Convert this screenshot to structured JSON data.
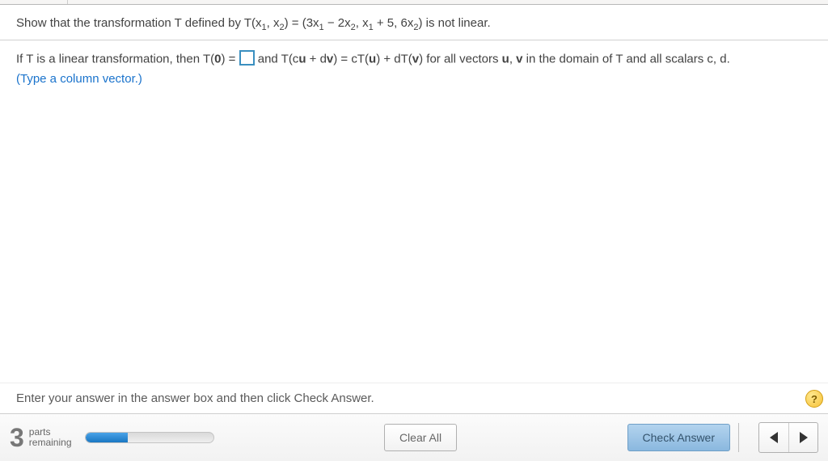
{
  "question": {
    "prefix": "Show that the transformation T defined by T(x",
    "s1": "1",
    "p2": ", x",
    "s2": "2",
    "p3": ") = (3x",
    "s3": "1",
    "p4": " − 2x",
    "s4": "2",
    "p5": ", x",
    "s5": "1",
    "p6": " + 5, 6x",
    "s6": "2",
    "suffix": ") is not linear."
  },
  "work": {
    "p1": "If T is a linear transformation, then T(",
    "b1": "0",
    "p2": ") = ",
    "p3": " and T(c",
    "b2": "u",
    "p4": " + d",
    "b3": "v",
    "p5": ") = cT(",
    "b4": "u",
    "p6": ") + dT(",
    "b5": "v",
    "p7": ") for all vectors ",
    "b6": "u",
    "p8": ", ",
    "b7": "v",
    "p9": " in the domain of T and all scalars c, d.",
    "hint": "(Type a column vector.)"
  },
  "footer": {
    "instruction": "Enter your answer in the answer box and then click Check Answer.",
    "help": "?",
    "parts_count": "3",
    "parts_label": "parts",
    "remaining_label": "remaining",
    "clear_all": "Clear All",
    "check_answer": "Check Answer"
  }
}
